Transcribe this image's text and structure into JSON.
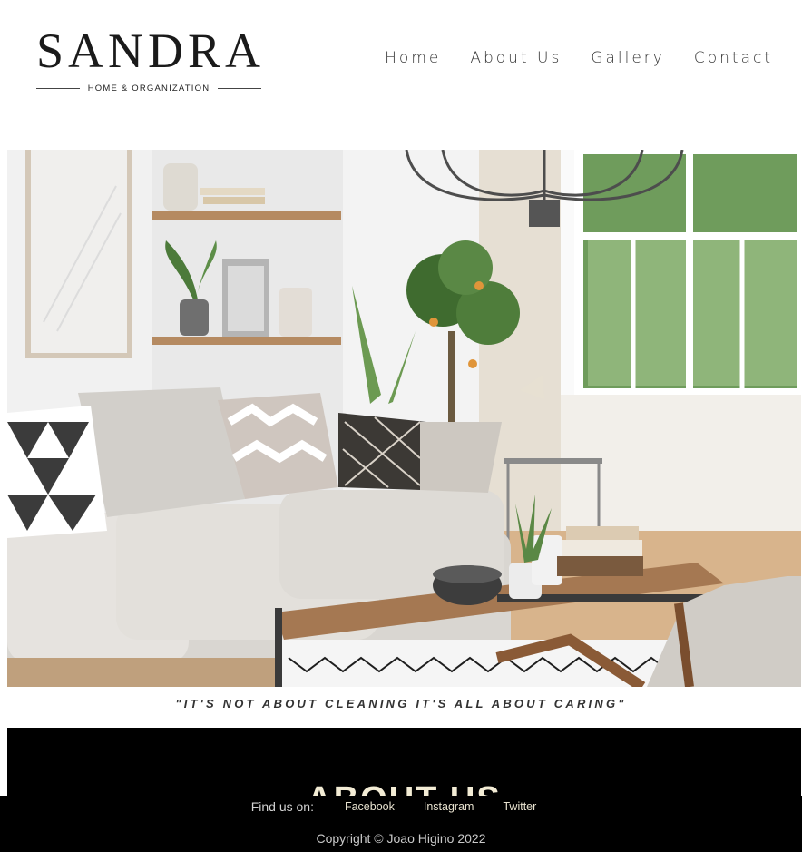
{
  "brand": {
    "name": "SANDRA",
    "tagline": "HOME & ORGANIZATION"
  },
  "nav": {
    "items": [
      {
        "label": "Home"
      },
      {
        "label": "About Us"
      },
      {
        "label": "Gallery"
      },
      {
        "label": "Contact"
      }
    ]
  },
  "hero": {
    "image_icon": "living-room-photo",
    "quote": "\"IT'S NOT ABOUT CLEANING IT'S ALL ABOUT CARING\""
  },
  "about": {
    "title": "ABOUT US"
  },
  "footer": {
    "find_label": "Find us on:",
    "links": [
      {
        "label": "Facebook"
      },
      {
        "label": "Instagram"
      },
      {
        "label": "Twitter"
      }
    ],
    "copyright": "Copyright © Joao Higino 2022"
  },
  "colors": {
    "background": "#ffffff",
    "band": "#000000",
    "accent_text": "#f3ecd5"
  }
}
